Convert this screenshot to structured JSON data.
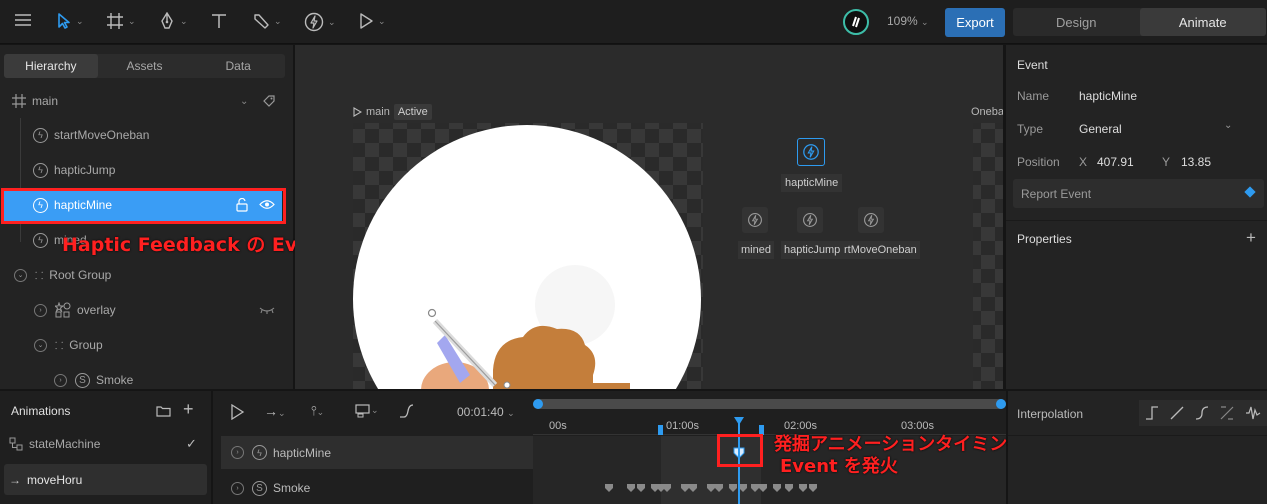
{
  "toolbar": {
    "zoom": "109%",
    "export_label": "Export",
    "modes": [
      "Design",
      "Animate"
    ],
    "active_mode": "Animate"
  },
  "left_panel": {
    "tabs": [
      "Hierarchy",
      "Assets",
      "Data"
    ],
    "artboard": "main",
    "items": [
      {
        "label": "startMoveOneban",
        "type": "event"
      },
      {
        "label": "hapticJump",
        "type": "event"
      },
      {
        "label": "hapticMine",
        "type": "event",
        "selected": true
      },
      {
        "label": "mined",
        "type": "event"
      },
      {
        "label": "Root Group",
        "type": "group"
      },
      {
        "label": "overlay",
        "type": "shape"
      },
      {
        "label": "Group",
        "type": "group"
      },
      {
        "label": "Smoke",
        "type": "solo"
      }
    ]
  },
  "stage": {
    "artboard_label": "main",
    "artboard_badge": "Active",
    "artboard2_label": "Oneba",
    "events": {
      "selected": "hapticMine",
      "others": [
        "mined",
        "hapticJump",
        "rtMoveOneban"
      ]
    }
  },
  "right_panel": {
    "section": "Event",
    "name_label": "Name",
    "name_value": "hapticMine",
    "type_label": "Type",
    "type_value": "General",
    "position_label": "Position",
    "x_label": "X",
    "x_value": "407.91",
    "y_label": "Y",
    "y_value": "13.85",
    "report_event": "Report Event",
    "properties": "Properties"
  },
  "animations": {
    "title": "Animations",
    "items": [
      {
        "label": "stateMachine"
      },
      {
        "label": "moveHoru",
        "active": true
      }
    ]
  },
  "timeline": {
    "time": "00:01:40",
    "ticks": [
      "00s",
      "01:00s",
      "02:00s",
      "03:00s"
    ],
    "tracks": [
      "hapticMine",
      "Smoke"
    ]
  },
  "interpolation": {
    "label": "Interpolation"
  },
  "annotations": {
    "hierarchy_note": "Haptic Feedback の Event",
    "timeline_note_line1": "発掘アニメーションタイミングで",
    "timeline_note_line2": "Event を発火"
  },
  "colors": {
    "accent": "#2e9bf0",
    "selected_row": "#3a9df5",
    "annotation_red": "#ff2020",
    "export_btn": "#2b6fb5"
  }
}
